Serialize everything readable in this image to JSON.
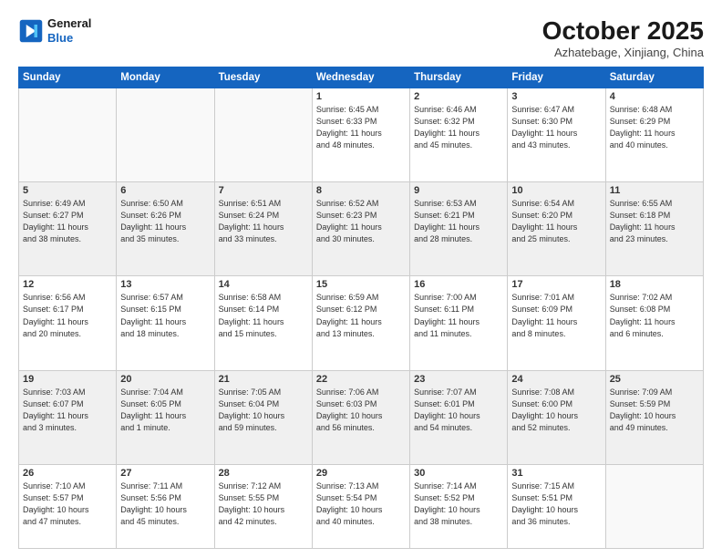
{
  "header": {
    "logo_line1": "General",
    "logo_line2": "Blue",
    "month": "October 2025",
    "location": "Azhatebage, Xinjiang, China"
  },
  "weekdays": [
    "Sunday",
    "Monday",
    "Tuesday",
    "Wednesday",
    "Thursday",
    "Friday",
    "Saturday"
  ],
  "weeks": [
    [
      {
        "day": "",
        "info": "",
        "empty": true
      },
      {
        "day": "",
        "info": "",
        "empty": true
      },
      {
        "day": "",
        "info": "",
        "empty": true
      },
      {
        "day": "1",
        "info": "Sunrise: 6:45 AM\nSunset: 6:33 PM\nDaylight: 11 hours\nand 48 minutes."
      },
      {
        "day": "2",
        "info": "Sunrise: 6:46 AM\nSunset: 6:32 PM\nDaylight: 11 hours\nand 45 minutes."
      },
      {
        "day": "3",
        "info": "Sunrise: 6:47 AM\nSunset: 6:30 PM\nDaylight: 11 hours\nand 43 minutes."
      },
      {
        "day": "4",
        "info": "Sunrise: 6:48 AM\nSunset: 6:29 PM\nDaylight: 11 hours\nand 40 minutes."
      }
    ],
    [
      {
        "day": "5",
        "info": "Sunrise: 6:49 AM\nSunset: 6:27 PM\nDaylight: 11 hours\nand 38 minutes."
      },
      {
        "day": "6",
        "info": "Sunrise: 6:50 AM\nSunset: 6:26 PM\nDaylight: 11 hours\nand 35 minutes."
      },
      {
        "day": "7",
        "info": "Sunrise: 6:51 AM\nSunset: 6:24 PM\nDaylight: 11 hours\nand 33 minutes."
      },
      {
        "day": "8",
        "info": "Sunrise: 6:52 AM\nSunset: 6:23 PM\nDaylight: 11 hours\nand 30 minutes."
      },
      {
        "day": "9",
        "info": "Sunrise: 6:53 AM\nSunset: 6:21 PM\nDaylight: 11 hours\nand 28 minutes."
      },
      {
        "day": "10",
        "info": "Sunrise: 6:54 AM\nSunset: 6:20 PM\nDaylight: 11 hours\nand 25 minutes."
      },
      {
        "day": "11",
        "info": "Sunrise: 6:55 AM\nSunset: 6:18 PM\nDaylight: 11 hours\nand 23 minutes."
      }
    ],
    [
      {
        "day": "12",
        "info": "Sunrise: 6:56 AM\nSunset: 6:17 PM\nDaylight: 11 hours\nand 20 minutes."
      },
      {
        "day": "13",
        "info": "Sunrise: 6:57 AM\nSunset: 6:15 PM\nDaylight: 11 hours\nand 18 minutes."
      },
      {
        "day": "14",
        "info": "Sunrise: 6:58 AM\nSunset: 6:14 PM\nDaylight: 11 hours\nand 15 minutes."
      },
      {
        "day": "15",
        "info": "Sunrise: 6:59 AM\nSunset: 6:12 PM\nDaylight: 11 hours\nand 13 minutes."
      },
      {
        "day": "16",
        "info": "Sunrise: 7:00 AM\nSunset: 6:11 PM\nDaylight: 11 hours\nand 11 minutes."
      },
      {
        "day": "17",
        "info": "Sunrise: 7:01 AM\nSunset: 6:09 PM\nDaylight: 11 hours\nand 8 minutes."
      },
      {
        "day": "18",
        "info": "Sunrise: 7:02 AM\nSunset: 6:08 PM\nDaylight: 11 hours\nand 6 minutes."
      }
    ],
    [
      {
        "day": "19",
        "info": "Sunrise: 7:03 AM\nSunset: 6:07 PM\nDaylight: 11 hours\nand 3 minutes."
      },
      {
        "day": "20",
        "info": "Sunrise: 7:04 AM\nSunset: 6:05 PM\nDaylight: 11 hours\nand 1 minute."
      },
      {
        "day": "21",
        "info": "Sunrise: 7:05 AM\nSunset: 6:04 PM\nDaylight: 10 hours\nand 59 minutes."
      },
      {
        "day": "22",
        "info": "Sunrise: 7:06 AM\nSunset: 6:03 PM\nDaylight: 10 hours\nand 56 minutes."
      },
      {
        "day": "23",
        "info": "Sunrise: 7:07 AM\nSunset: 6:01 PM\nDaylight: 10 hours\nand 54 minutes."
      },
      {
        "day": "24",
        "info": "Sunrise: 7:08 AM\nSunset: 6:00 PM\nDaylight: 10 hours\nand 52 minutes."
      },
      {
        "day": "25",
        "info": "Sunrise: 7:09 AM\nSunset: 5:59 PM\nDaylight: 10 hours\nand 49 minutes."
      }
    ],
    [
      {
        "day": "26",
        "info": "Sunrise: 7:10 AM\nSunset: 5:57 PM\nDaylight: 10 hours\nand 47 minutes."
      },
      {
        "day": "27",
        "info": "Sunrise: 7:11 AM\nSunset: 5:56 PM\nDaylight: 10 hours\nand 45 minutes."
      },
      {
        "day": "28",
        "info": "Sunrise: 7:12 AM\nSunset: 5:55 PM\nDaylight: 10 hours\nand 42 minutes."
      },
      {
        "day": "29",
        "info": "Sunrise: 7:13 AM\nSunset: 5:54 PM\nDaylight: 10 hours\nand 40 minutes."
      },
      {
        "day": "30",
        "info": "Sunrise: 7:14 AM\nSunset: 5:52 PM\nDaylight: 10 hours\nand 38 minutes."
      },
      {
        "day": "31",
        "info": "Sunrise: 7:15 AM\nSunset: 5:51 PM\nDaylight: 10 hours\nand 36 minutes."
      },
      {
        "day": "",
        "info": "",
        "empty": true
      }
    ]
  ]
}
